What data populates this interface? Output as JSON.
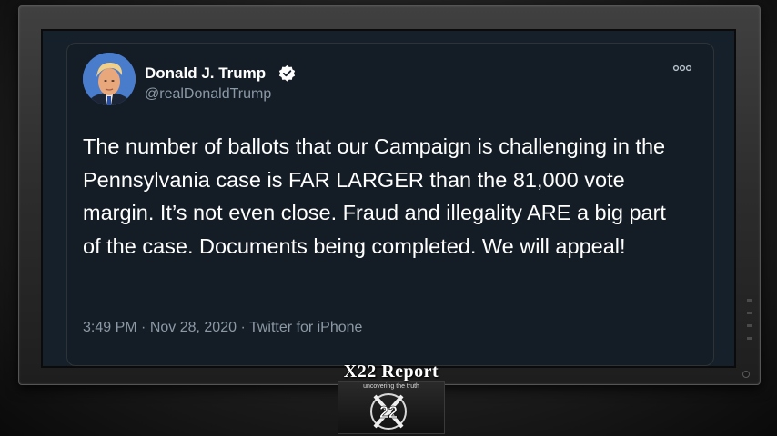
{
  "tweet": {
    "author_name": "Donald J. Trump",
    "handle": "@realDonaldTrump",
    "text": "The number of ballots that our Campaign is challenging in the Pennsylvania case is FAR LARGER than the 81,000 vote margin. It’s not even close. Fraud and illegality ARE a big part of the case. Documents being completed. We will appeal!",
    "time": "3:49 PM",
    "date": "Nov 28, 2020",
    "source": "Twitter for iPhone",
    "separator": " · ",
    "icons": {
      "verified": "verified-badge-icon",
      "more": "more-options-icon"
    }
  },
  "overlay": {
    "title": "X22 Report",
    "subtitle": "uncovering the truth",
    "emblem_text": "22"
  },
  "colors": {
    "tweet_background": "#15202b",
    "text": "#ffffff",
    "secondary_text": "#8b98a5",
    "verified": "#ffffff"
  }
}
